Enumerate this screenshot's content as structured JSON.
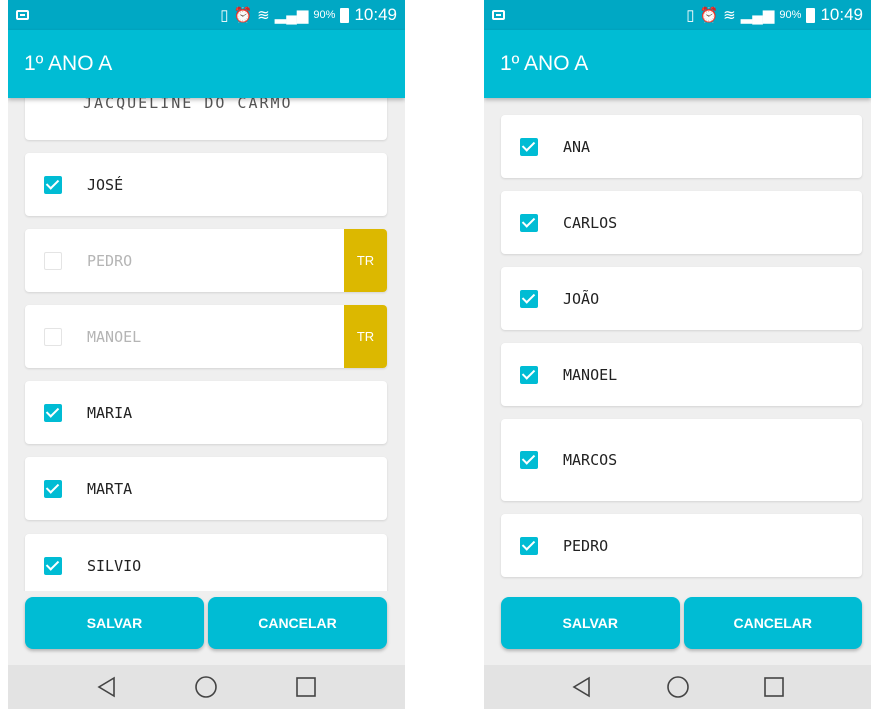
{
  "status_bar": {
    "battery": "90%",
    "time": "10:49"
  },
  "screens": [
    {
      "title": "1º ANO A",
      "partial_item": "JACQUELINE DO CARMO",
      "items": [
        {
          "name": "JOSÉ",
          "checked": true
        },
        {
          "name": "PEDRO",
          "checked": false,
          "tag": "TR"
        },
        {
          "name": "MANOEL",
          "checked": false,
          "tag": "TR"
        },
        {
          "name": "MARIA",
          "checked": true
        },
        {
          "name": "MARTA",
          "checked": true
        },
        {
          "name": "SILVIO",
          "checked": true
        }
      ],
      "save_label": "SALVAR",
      "cancel_label": "CANCELAR"
    },
    {
      "title": "1º ANO A",
      "items": [
        {
          "name": "ANA",
          "checked": true
        },
        {
          "name": "CARLOS",
          "checked": true
        },
        {
          "name": "JOÃO",
          "checked": true
        },
        {
          "name": "MANOEL",
          "checked": true
        },
        {
          "name": "MARCOS",
          "checked": true
        },
        {
          "name": "PEDRO",
          "checked": true
        }
      ],
      "save_label": "SALVAR",
      "cancel_label": "CANCELAR"
    }
  ],
  "icons": {
    "back": "back-triangle-icon",
    "home": "home-circle-icon",
    "recents": "recents-square-icon"
  },
  "colors": {
    "status_bar": "#00a8c4",
    "app_bar": "#00bcd4",
    "accent": "#00bcd4",
    "tag": "#dcb800"
  }
}
